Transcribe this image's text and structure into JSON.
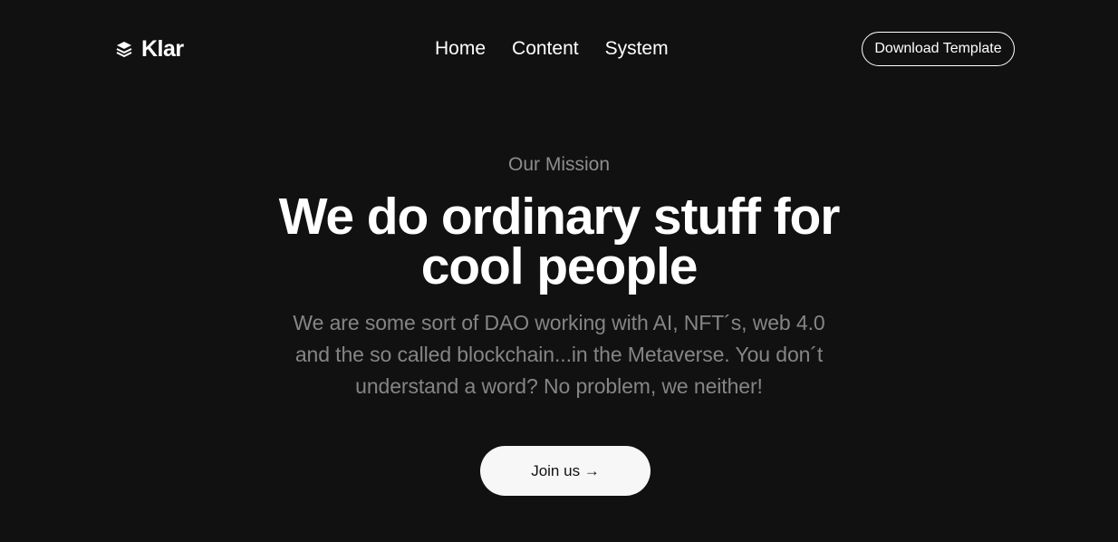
{
  "header": {
    "brand": {
      "name": "Klar",
      "icon": "layers-icon"
    },
    "nav": [
      {
        "label": "Home"
      },
      {
        "label": "Content"
      },
      {
        "label": "System"
      }
    ],
    "download_button_label": "Download Template"
  },
  "hero": {
    "eyebrow": "Our Mission",
    "title_line_1": "We do ordinary stuff for",
    "title_line_2": "cool people",
    "description": "We are some sort of DAO working with AI, NFT´s, web 4.0 and the so called blockchain...in the Metaverse. You don´t understand a word? No problem, we neither!",
    "cta_label": "Join us →"
  },
  "colors": {
    "background": "#111111",
    "text_primary": "#ffffff",
    "text_muted": "#858585",
    "button_light": "#f7f7f7"
  }
}
